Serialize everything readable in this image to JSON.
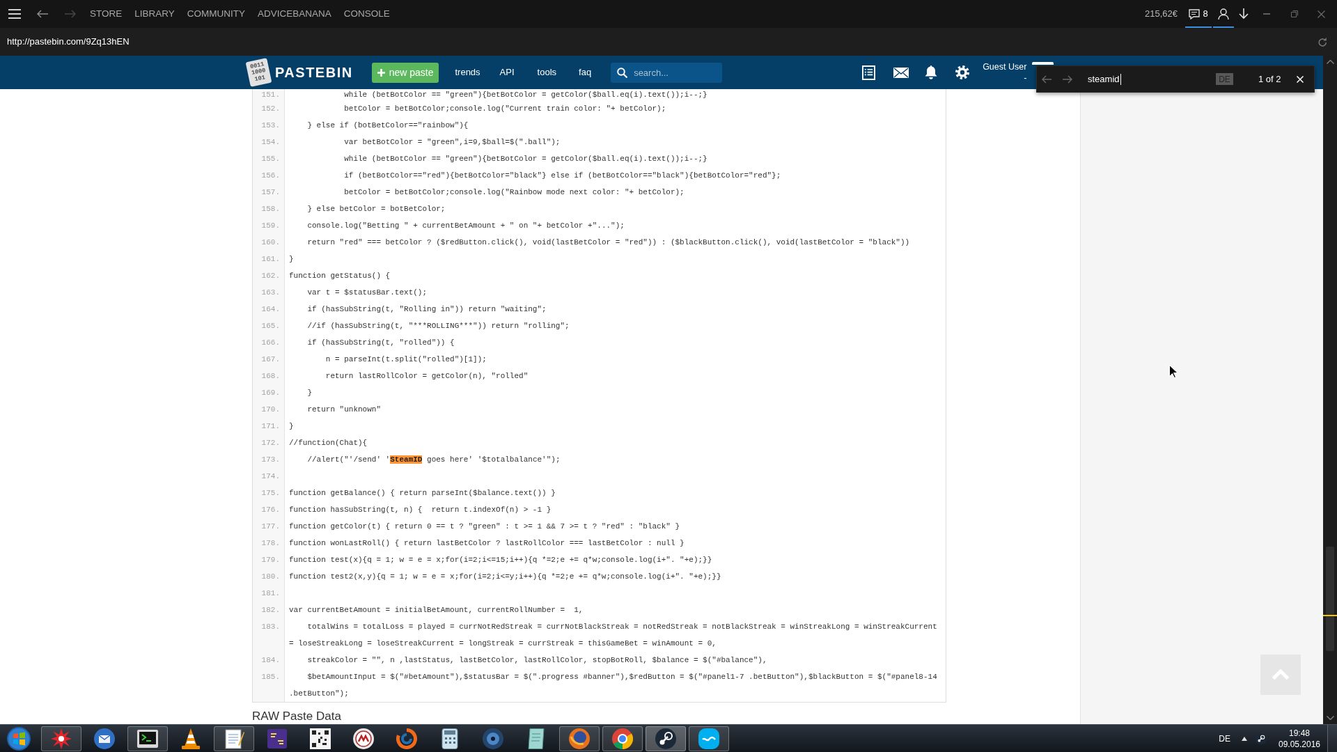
{
  "client_header": {
    "history_buttons": [
      {
        "disabled": false
      },
      {
        "disabled": true
      }
    ],
    "menu": [
      "STORE",
      "LIBRARY",
      "COMMUNITY",
      "ADVICEBANANA",
      "CONSOLE"
    ],
    "wallet": "215,62€",
    "header_buttons": [
      {
        "count": "8",
        "underlined": true
      },
      {
        "underlined": true
      },
      {
        "underlined": false
      }
    ]
  },
  "address_bar": {
    "url": "http://pastebin.com/9Zq13hEN"
  },
  "site_nav": {
    "logo_digits": [
      "0011",
      "1000",
      "101"
    ],
    "logo_text": "PASTEBIN",
    "new_paste_button": "new paste",
    "links": [
      "trends",
      "API",
      "tools",
      "faq"
    ],
    "search": {
      "placeholder": "search..."
    },
    "user": {
      "name": "Guest User",
      "status": "-"
    }
  },
  "find_bar": {
    "query": "steamid",
    "language": "DE",
    "result": "1 of 2"
  },
  "code": {
    "lines": [
      {
        "number": "151.",
        "parts": [
          {
            "text": "            while (betBotColor == \"green\"){betBotColor = getColor($ball.eq(i).text());i--;}",
            "highlighted": false
          }
        ]
      },
      {
        "number": "152.",
        "parts": [
          {
            "text": "            betColor = betBotColor;console.log(\"Current train color: \"+ betColor);",
            "highlighted": false
          }
        ]
      },
      {
        "number": "153.",
        "parts": [
          {
            "text": "    } else if (botBetColor==\"rainbow\"){",
            "highlighted": false
          }
        ]
      },
      {
        "number": "154.",
        "parts": [
          {
            "text": "            var betBotColor = \"green\",i=9,$ball=$(\".ball\");",
            "highlighted": false
          }
        ]
      },
      {
        "number": "155.",
        "parts": [
          {
            "text": "            while (betBotColor == \"green\"){betBotColor = getColor($ball.eq(i).text());i--;}",
            "highlighted": false
          }
        ]
      },
      {
        "number": "156.",
        "parts": [
          {
            "text": "            if (betBotColor==\"red\"){betBotColor=\"black\"} else if (betBotColor==\"black\"){betBotColor=\"red\"};",
            "highlighted": false
          }
        ]
      },
      {
        "number": "157.",
        "parts": [
          {
            "text": "            betColor = betBotColor;console.log(\"Rainbow mode next color: \"+ betColor);",
            "highlighted": false
          }
        ]
      },
      {
        "number": "158.",
        "parts": [
          {
            "text": "    } else betColor = botBetColor;",
            "highlighted": false
          }
        ]
      },
      {
        "number": "159.",
        "parts": [
          {
            "text": "    console.log(\"Betting \" + currentBetAmount + \" on \"+ betColor +\"...\");",
            "highlighted": false
          }
        ]
      },
      {
        "number": "160.",
        "parts": [
          {
            "text": "    return \"red\" === betColor ? ($redButton.click(), void(lastBetColor = \"red\")) : ($blackButton.click(), void(lastBetColor = \"black\"))",
            "highlighted": false
          }
        ]
      },
      {
        "number": "161.",
        "parts": [
          {
            "text": "}",
            "highlighted": false
          }
        ]
      },
      {
        "number": "162.",
        "parts": [
          {
            "text": "function getStatus() {",
            "highlighted": false
          }
        ]
      },
      {
        "number": "163.",
        "parts": [
          {
            "text": "    var t = $statusBar.text();",
            "highlighted": false
          }
        ]
      },
      {
        "number": "164.",
        "parts": [
          {
            "text": "    if (hasSubString(t, \"Rolling in\")) return \"waiting\";",
            "highlighted": false
          }
        ]
      },
      {
        "number": "165.",
        "parts": [
          {
            "text": "    //if (hasSubString(t, \"***ROLLING***\")) return \"rolling\";",
            "highlighted": false
          }
        ]
      },
      {
        "number": "166.",
        "parts": [
          {
            "text": "    if (hasSubString(t, \"rolled\")) {",
            "highlighted": false
          }
        ]
      },
      {
        "number": "167.",
        "parts": [
          {
            "text": "        n = parseInt(t.split(\"rolled\")[1]);",
            "highlighted": false
          }
        ]
      },
      {
        "number": "168.",
        "parts": [
          {
            "text": "        return lastRollColor = getColor(n), \"rolled\"",
            "highlighted": false
          }
        ]
      },
      {
        "number": "169.",
        "parts": [
          {
            "text": "    }",
            "highlighted": false
          }
        ]
      },
      {
        "number": "170.",
        "parts": [
          {
            "text": "    return \"unknown\"",
            "highlighted": false
          }
        ]
      },
      {
        "number": "171.",
        "parts": [
          {
            "text": "}",
            "highlighted": false
          }
        ]
      },
      {
        "number": "172.",
        "parts": [
          {
            "text": "//function(Chat){",
            "highlighted": false
          }
        ]
      },
      {
        "number": "173.",
        "parts": [
          {
            "text": "    //alert(\"'/send' '",
            "highlighted": false
          },
          {
            "text": "SteamID",
            "highlighted": true
          },
          {
            "text": " goes here' '$totalbalance'\");",
            "highlighted": false
          }
        ]
      },
      {
        "number": "174."
      },
      {
        "number": "175.",
        "parts": [
          {
            "text": "function getBalance() { return parseInt($balance.text()) }",
            "highlighted": false
          }
        ]
      },
      {
        "number": "176.",
        "parts": [
          {
            "text": "function hasSubString(t, n) {  return t.indexOf(n) > -1 }",
            "highlighted": false
          }
        ]
      },
      {
        "number": "177.",
        "parts": [
          {
            "text": "function getColor(t) { return 0 == t ? \"green\" : t >= 1 && 7 >= t ? \"red\" : \"black\" }",
            "highlighted": false
          }
        ]
      },
      {
        "number": "178.",
        "parts": [
          {
            "text": "function wonLastRoll() { return lastBetColor ? lastRollColor === lastBetColor : null }",
            "highlighted": false
          }
        ]
      },
      {
        "number": "179.",
        "parts": [
          {
            "text": "function test(x){q = 1; w = e = x;for(i=2;i<=15;i++){q *=2;e += q*w;console.log(i+\". \"+e);}}",
            "highlighted": false
          }
        ]
      },
      {
        "number": "180.",
        "parts": [
          {
            "text": "function test2(x,y){q = 1; w = e = x;for(i=2;i<=y;i++){q *=2;e += q*w;console.log(i+\". \"+e);}}",
            "highlighted": false
          }
        ]
      },
      {
        "number": "181."
      },
      {
        "number": "182.",
        "parts": [
          {
            "text": "var currentBetAmount = initialBetAmount, currentRollNumber =  1,",
            "highlighted": false
          }
        ]
      },
      {
        "number": "183.",
        "parts": [
          {
            "text": "    totalWins = totalLoss = played = currNotRedStreak = currNotBlackStreak = notRedStreak = notBlackStreak = winStreakLong = winStreakCurrent = loseStreakLong = loseStreakCurrent = longStreak = currStreak = thisGameBet = winAmount = 0,",
            "highlighted": false
          }
        ]
      },
      {
        "number": "184.",
        "parts": [
          {
            "text": "    streakColor = \"\", n ,lastStatus, lastBetColor, lastRollColor, stopBotRoll, $balance = $(\"#balance\"),",
            "highlighted": false
          }
        ]
      },
      {
        "number": "185.",
        "parts": [
          {
            "text": "    $betAmountInput = $(\"#betAmount\"),$statusBar = $(\".progress #banner\"),$redButton = $(\"#panel1-7 .betButton\"),$blackButton = $(\"#panel8-14 .betButton\");",
            "highlighted": false
          }
        ]
      }
    ]
  },
  "raw_heading": "RAW Paste Data",
  "taskbar": {
    "apps": [
      {
        "open": true,
        "selected": false
      },
      {
        "open": false,
        "selected": false
      },
      {
        "open": true,
        "selected": false
      },
      {
        "open": false,
        "selected": false
      },
      {
        "open": true,
        "selected": false
      },
      {
        "open": false,
        "selected": false
      },
      {
        "open": false,
        "selected": false
      },
      {
        "open": false,
        "selected": false
      },
      {
        "open": false,
        "selected": false
      },
      {
        "open": false,
        "selected": false
      },
      {
        "open": false,
        "selected": false
      },
      {
        "open": false,
        "selected": false
      },
      {
        "open": true,
        "selected": false
      },
      {
        "open": true,
        "selected": false
      },
      {
        "open": true,
        "selected": true
      },
      {
        "open": true,
        "selected": false
      }
    ],
    "language": "DE",
    "time": "19:48",
    "date": "09.05.2016"
  }
}
